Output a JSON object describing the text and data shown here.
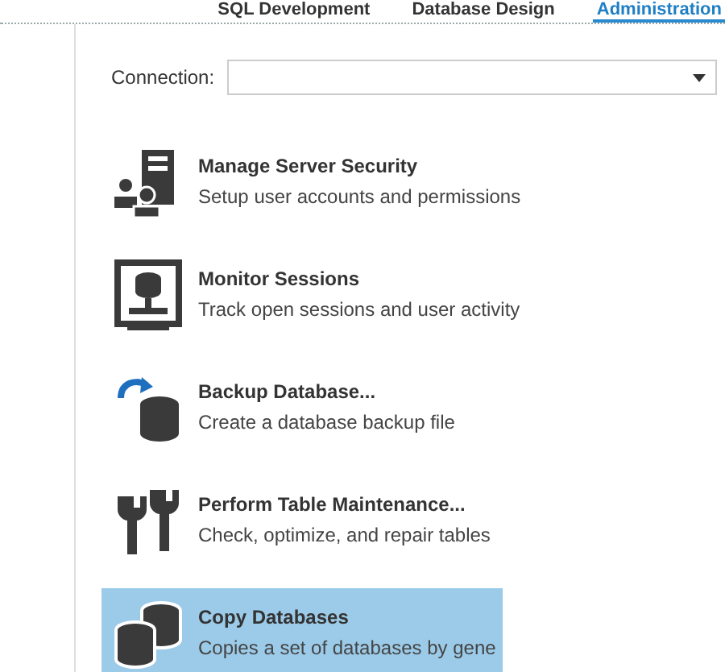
{
  "tabs": [
    {
      "label": "SQL Development",
      "selected": false
    },
    {
      "label": "Database Design",
      "selected": false
    },
    {
      "label": "Administration",
      "selected": true
    }
  ],
  "connection": {
    "label": "Connection:"
  },
  "tasks": [
    {
      "kind": "security",
      "title": "Manage Server Security",
      "description": "Setup user accounts and permissions",
      "selected": false
    },
    {
      "kind": "monitor",
      "title": "Monitor Sessions",
      "description": "Track open sessions and user activity",
      "selected": false
    },
    {
      "kind": "backup",
      "title": "Backup Database...",
      "description": "Create a database backup file",
      "selected": false
    },
    {
      "kind": "maintenance",
      "title": "Perform Table Maintenance...",
      "description": "Check, optimize, and repair tables",
      "selected": false
    },
    {
      "kind": "copy",
      "title": "Copy Databases",
      "description": "Copies a set of databases by gene",
      "selected": true
    }
  ]
}
